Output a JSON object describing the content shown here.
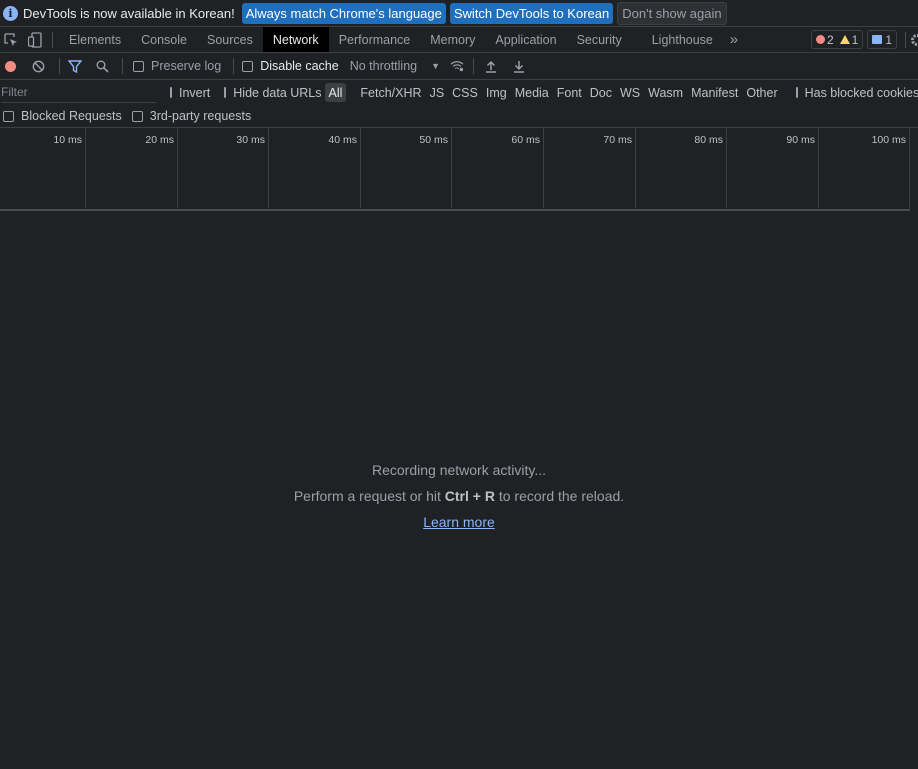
{
  "infobar": {
    "message": "DevTools is now available in Korean!",
    "btn_match": "Always match Chrome's language",
    "btn_switch": "Switch DevTools to Korean",
    "btn_dismiss": "Don't show again"
  },
  "tabs": [
    "Elements",
    "Console",
    "Sources",
    "Network",
    "Performance",
    "Memory",
    "Application",
    "Security",
    "Lighthouse"
  ],
  "active_tab": "Network",
  "counts": {
    "errors": "2",
    "warnings": "1",
    "messages": "1"
  },
  "toolbar": {
    "preserve_log": "Preserve log",
    "disable_cache": "Disable cache",
    "throttling": "No throttling"
  },
  "filter": {
    "placeholder": "Filter",
    "invert": "Invert",
    "hide_data_urls": "Hide data URLs",
    "types": [
      "All",
      "Fetch/XHR",
      "JS",
      "CSS",
      "Img",
      "Media",
      "Font",
      "Doc",
      "WS",
      "Wasm",
      "Manifest",
      "Other"
    ],
    "has_blocked_cookies": "Has blocked cookies",
    "blocked_requests": "Blocked Requests",
    "third_party": "3rd-party requests"
  },
  "timeline_ticks": [
    "10 ms",
    "20 ms",
    "30 ms",
    "40 ms",
    "50 ms",
    "60 ms",
    "70 ms",
    "80 ms",
    "90 ms",
    "100 ms"
  ],
  "empty": {
    "recording": "Recording network activity...",
    "perform_pre": "Perform a request or hit ",
    "shortcut": "Ctrl + R",
    "perform_post": " to record the reload.",
    "learn_more": "Learn more"
  }
}
